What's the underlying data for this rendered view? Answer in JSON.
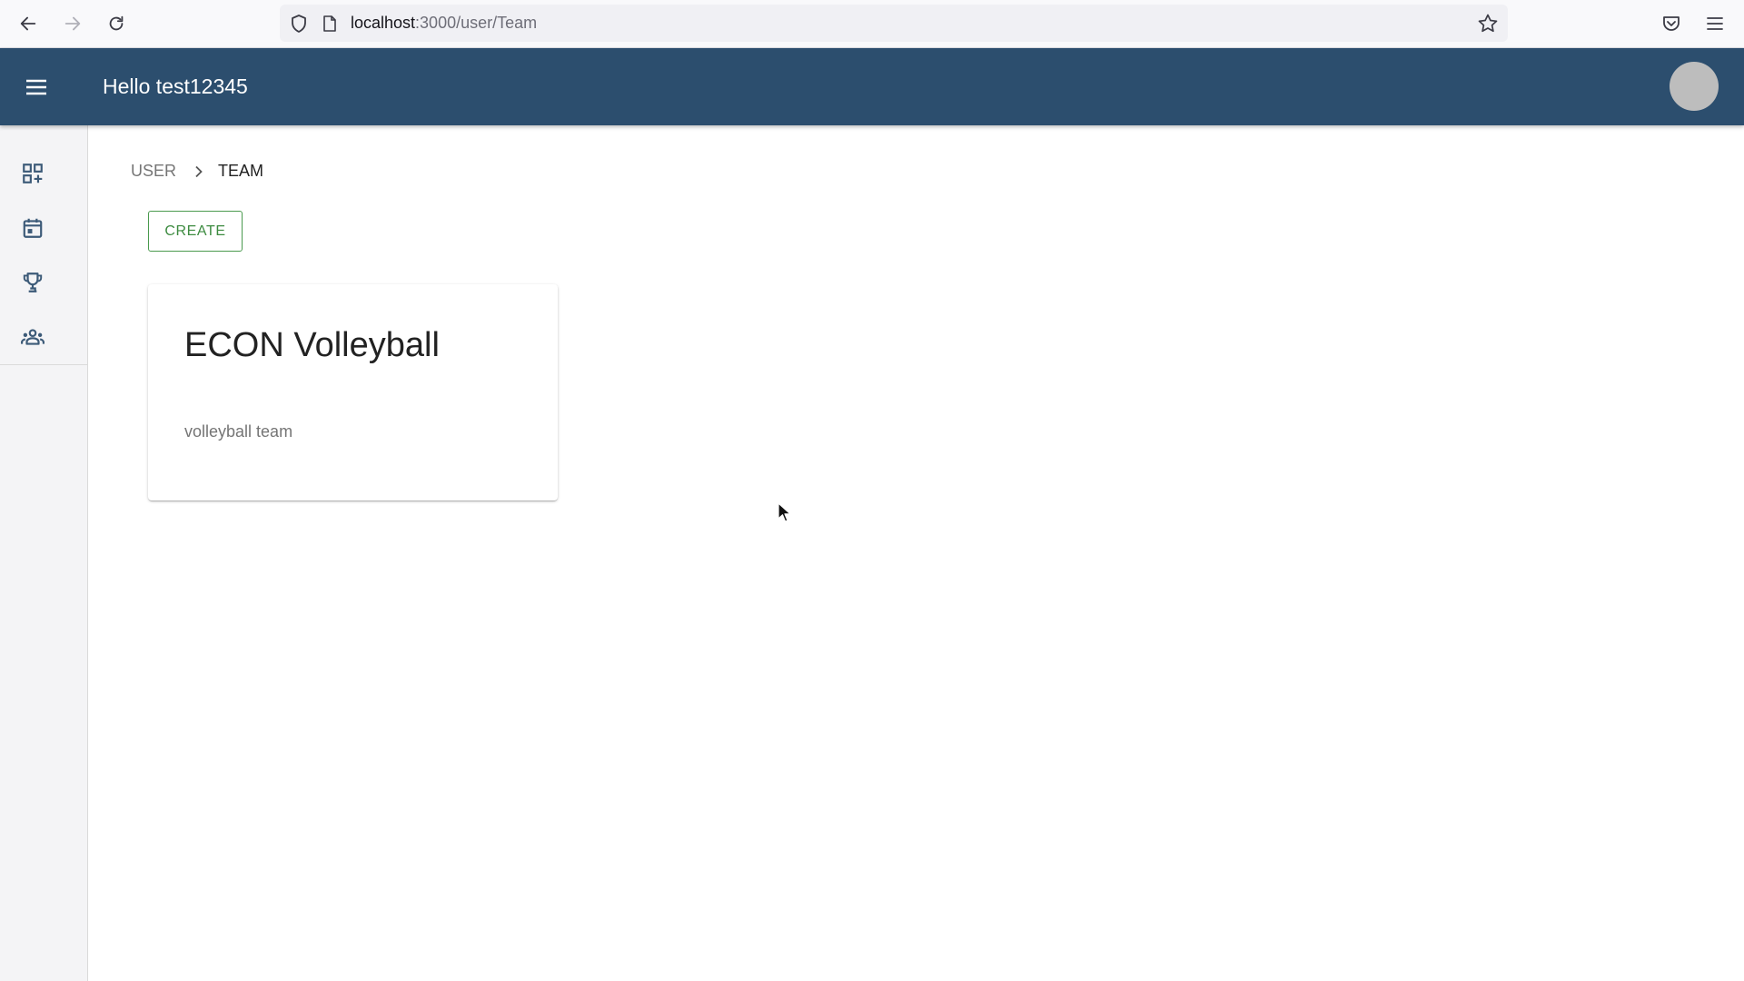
{
  "browser": {
    "url_host": "localhost",
    "url_path": ":3000/user/Team",
    "icons": [
      "back-arrow-icon",
      "forward-arrow-icon",
      "reload-icon",
      "shield-icon",
      "page-icon",
      "bookmark-star-icon",
      "pocket-icon",
      "hamburger-menu-icon"
    ]
  },
  "header": {
    "greeting": "Hello test12345",
    "bg_color": "#2c4e6e"
  },
  "sidebar": {
    "items": [
      {
        "icon": "dashboard-add-icon"
      },
      {
        "icon": "calendar-icon"
      },
      {
        "icon": "trophy-icon"
      },
      {
        "icon": "groups-icon"
      }
    ]
  },
  "breadcrumb": {
    "parent": "USER",
    "current": "TEAM"
  },
  "toolbar": {
    "create_label": "CREATE",
    "accent_color": "#3d8b40"
  },
  "teams": [
    {
      "name": "ECON Volleyball",
      "description": "volleyball team"
    }
  ]
}
